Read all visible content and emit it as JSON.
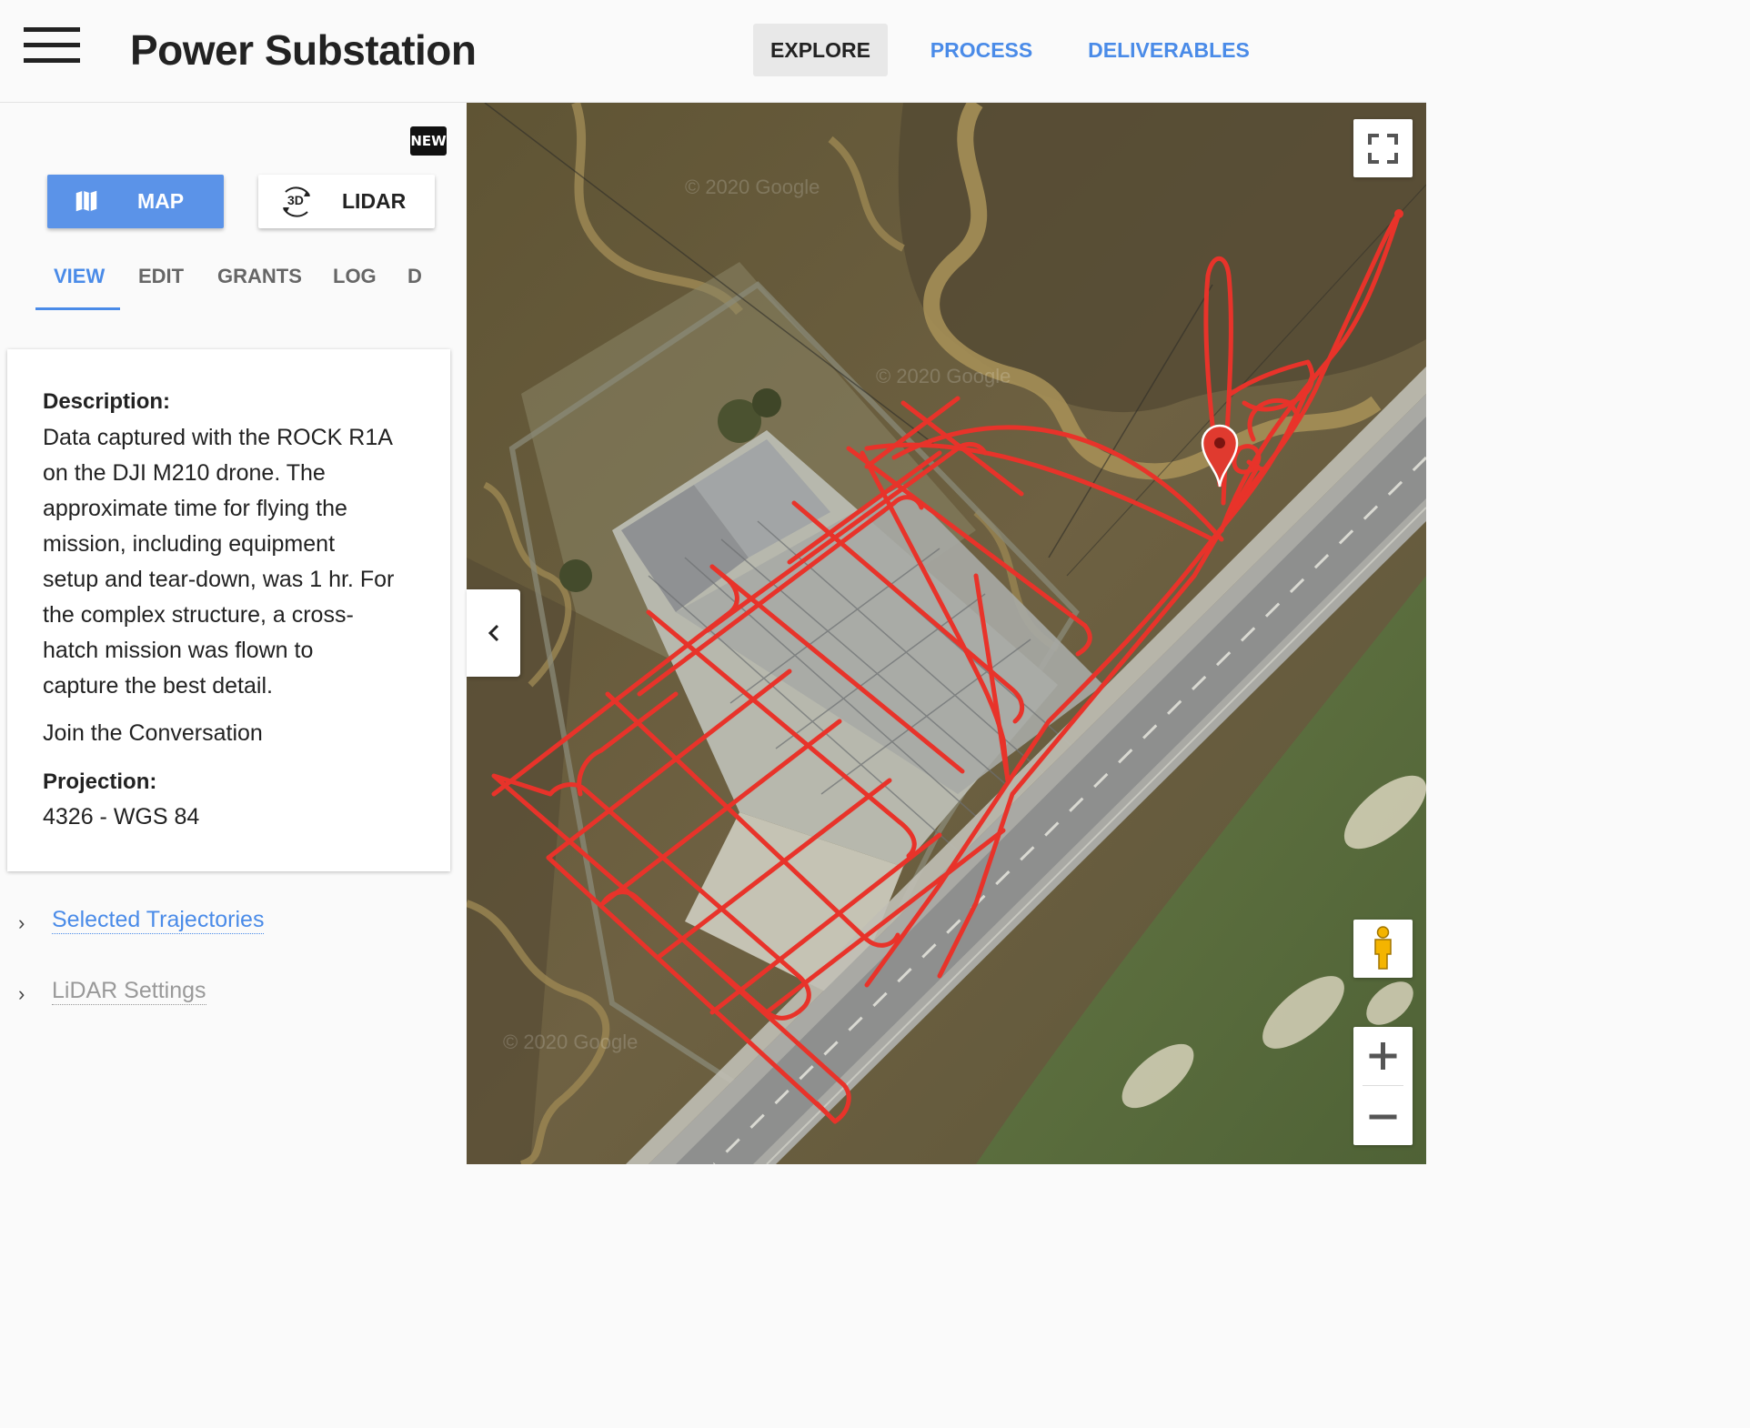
{
  "header": {
    "menu_icon": "hamburger-menu-icon",
    "title": "Power Substation",
    "tabs": [
      {
        "label": "EXPLORE",
        "active": true
      },
      {
        "label": "PROCESS",
        "active": false
      },
      {
        "label": "DELIVERABLES",
        "active": false
      }
    ]
  },
  "sidebar": {
    "new_badge": "NEW",
    "view_toggle": {
      "map_label": "MAP",
      "map_icon": "map-icon",
      "lidar_label": "LIDAR",
      "lidar_icon": "3d-rotate-icon",
      "lidar_icon_text": "3D",
      "active": "MAP"
    },
    "subtabs": [
      {
        "label": "VIEW",
        "active": true
      },
      {
        "label": "EDIT",
        "active": false
      },
      {
        "label": "GRANTS",
        "active": false
      },
      {
        "label": "LOG",
        "active": false
      },
      {
        "label": "D",
        "active": false
      }
    ],
    "details": {
      "description_label": "Description:",
      "description_lines": [
        "Data captured with the ROCK R1A",
        "on the DJI M210 drone.  The",
        "approximate time for flying the",
        "mission, including equipment",
        "setup and tear-down, was 1 hr.  For",
        "the complex structure, a cross-",
        "hatch mission was flown to",
        "capture the best detail."
      ],
      "conversation_link": "Join the Conversation",
      "projection_label": "Projection:",
      "projection_value": "4326 - WGS 84"
    },
    "sections": [
      {
        "label": "Selected Trajectories",
        "color": "#4a8be8"
      },
      {
        "label": "LiDAR Settings",
        "color": "#999999"
      }
    ]
  },
  "map": {
    "watermark": "© 2020 Google",
    "controls": {
      "fullscreen_icon": "fullscreen-icon",
      "pegman_icon": "street-view-pegman-icon",
      "zoom_in_icon": "zoom-in-icon",
      "zoom_out_icon": "zoom-out-icon",
      "collapse_icon": "chevron-left-icon"
    },
    "flight_path_color": "#e8332a",
    "marker_color": "#e03a2f"
  }
}
